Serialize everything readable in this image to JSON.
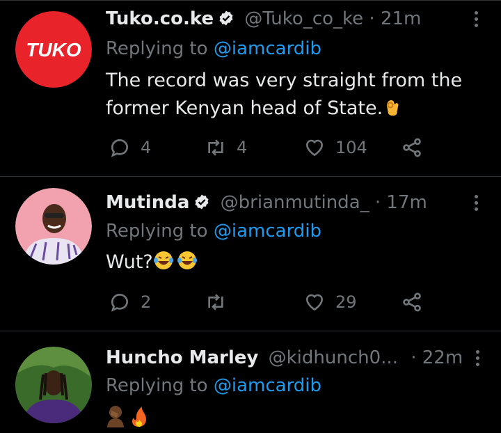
{
  "tweets": [
    {
      "name": "Tuko.co.ke",
      "verified": true,
      "handle": "@Tuko_co_ke",
      "sep": "·",
      "time": "21m",
      "replying_prefix": "Replying to ",
      "replying_to": "@iamcardib",
      "text_line1": "The record was very straight from the",
      "text_line2": "former Kenyan head of State.",
      "emoji": "ok-hand-emoji",
      "avatar_text": "TUKO",
      "avatar_color": "#e8242a",
      "replies": "4",
      "retweets": "4",
      "likes": "104"
    },
    {
      "name": "Mutinda",
      "verified": true,
      "handle": "@brianmutinda_",
      "sep": "·",
      "time": "17m",
      "replying_prefix": "Replying to ",
      "replying_to": "@iamcardib",
      "text": "Wut?",
      "emoji": "laughing-tears-emoji",
      "avatar_color": "#f2a1ae",
      "replies": "2",
      "retweets": "",
      "likes": "29"
    },
    {
      "name": "Huncho Marley",
      "verified": false,
      "handle": "@kidhunch0...",
      "sep": "·",
      "time": "22m",
      "replying_prefix": "Replying to ",
      "replying_to": "@iamcardib",
      "emoji": "facepalm-fire-emoji",
      "avatar_color": "#3b6b2b"
    }
  ],
  "colors": {
    "background": "#000000",
    "text": "#e7e9ea",
    "muted": "#71767b",
    "accent": "#1d9bf0",
    "divider": "#2f3336"
  },
  "icons": [
    "verified-badge-icon",
    "more-icon",
    "reply-icon",
    "retweet-icon",
    "like-icon",
    "share-icon"
  ]
}
